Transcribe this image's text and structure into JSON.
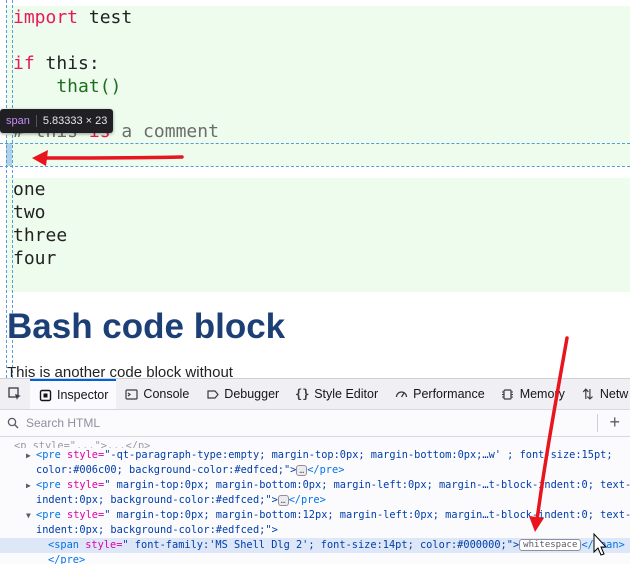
{
  "code_block_1": {
    "lines": [
      {
        "kw": "import",
        "rest": " test"
      },
      {
        "kw": "if",
        "rest": " this:"
      },
      {
        "fn": "    that()"
      },
      {
        "comment_prefix": "# this ",
        "comment_kw": "is",
        "comment_rest": " a comment"
      }
    ]
  },
  "code_block_2": {
    "lines": [
      "one",
      "two",
      "three",
      "four"
    ]
  },
  "tooltip": {
    "tag": "span",
    "dimensions": "5.83333 × 23"
  },
  "heading": "Bash code block",
  "paragraph": "This is another code block without",
  "devtools": {
    "tabs": [
      {
        "icon": "pick-element-icon",
        "label": ""
      },
      {
        "icon": "inspector-icon",
        "label": "Inspector"
      },
      {
        "icon": "console-icon",
        "label": "Console"
      },
      {
        "icon": "debugger-icon",
        "label": "Debugger"
      },
      {
        "icon": "style-editor-icon",
        "label": "Style Editor"
      },
      {
        "icon": "performance-icon",
        "label": "Performance"
      },
      {
        "icon": "memory-icon",
        "label": "Memory"
      },
      {
        "icon": "network-icon",
        "label": "Netw"
      }
    ],
    "search_placeholder": "Search HTML",
    "rows": {
      "r0": {
        "text": "<p style=\"...\">...</p>"
      },
      "r1": {
        "attr": " style=",
        "val": "\"-qt-paragraph-type:empty; margin-top:0px; margin-bottom:0px;…w' ; font-size:15pt;",
        "cont": "color:#006c00; background-color:#edfced;\">",
        "close": "</pre>"
      },
      "r2": {
        "attr": " style=",
        "val": "\" margin-top:0px; margin-bottom:0px; margin-left:0px; margin-…t-block-indent:0; text-",
        "cont": "indent:0px; background-color:#edfced;\">",
        "close": "</pre>"
      },
      "r3": {
        "attr": " style=",
        "val": "\" margin-top:0px; margin-bottom:12px; margin-left:0px; margin…t-block-indent:0; text-",
        "cont": "indent:0px; background-color:#edfced;\">"
      },
      "r4": {
        "attr": " style=",
        "val": "\" font-family:'MS Shell Dlg 2'; font-size:14pt; color:#000000;\">",
        "ws": "whitespace",
        "close": "</span>"
      },
      "r5": {
        "close": "</pre>"
      }
    },
    "badge": "…"
  },
  "colors": {
    "code_bg": "#edfced",
    "accent": "#0061e0",
    "arrow": "#e8141e",
    "heading": "#1c3f75"
  }
}
